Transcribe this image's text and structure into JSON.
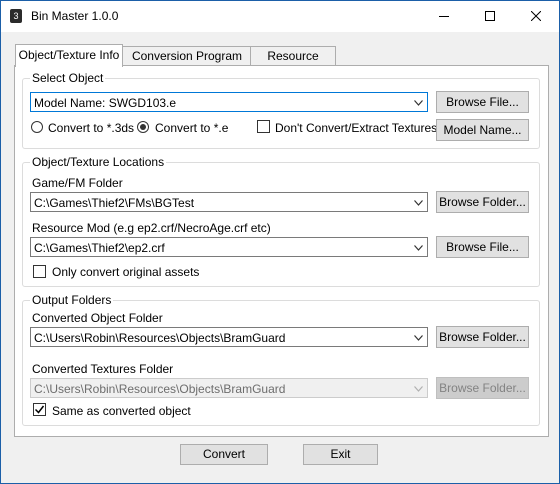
{
  "window": {
    "title": "Bin Master 1.0.0",
    "controls": {
      "minimize": "minimize-icon",
      "maximize": "maximize-icon",
      "close": "close-icon"
    }
  },
  "tabs": [
    {
      "label": "Object/Texture Info",
      "active": true
    },
    {
      "label": "Conversion Program Info",
      "active": false
    },
    {
      "label": "Resource Paths",
      "active": false
    }
  ],
  "select_object": {
    "legend": "Select Object",
    "model_name_value": "Model Name: SWGD103.e",
    "browse_file_label": "Browse File...",
    "radio_3ds_label": "Convert to *.3ds",
    "radio_3ds_checked": false,
    "radio_e_label": "Convert to *.e",
    "radio_e_checked": true,
    "dont_convert_label": "Don't Convert/Extract Textures",
    "dont_convert_checked": false,
    "model_name_button_label": "Model Name..."
  },
  "locations": {
    "legend": "Object/Texture Locations",
    "game_fm_label": "Game/FM Folder",
    "game_fm_value": "C:\\Games\\Thief2\\FMs\\BGTest",
    "browse_folder_label": "Browse Folder...",
    "resource_mod_label": "Resource Mod (e.g ep2.crf/NecroAge.crf etc)",
    "resource_mod_value": "C:\\Games\\Thief2\\ep2.crf",
    "browse_file_label": "Browse File...",
    "only_original_label": "Only convert original assets",
    "only_original_checked": false
  },
  "output": {
    "legend": "Output Folders",
    "converted_object_label": "Converted Object Folder",
    "converted_object_value": "C:\\Users\\Robin\\Resources\\Objects\\BramGuard",
    "browse_folder_label": "Browse Folder...",
    "converted_textures_label": "Converted Textures Folder",
    "converted_textures_value": "C:\\Users\\Robin\\Resources\\Objects\\BramGuard",
    "browse_folder_disabled_label": "Browse Folder...",
    "same_as_label": "Same as converted object",
    "same_as_checked": true
  },
  "footer": {
    "convert_label": "Convert",
    "exit_label": "Exit"
  }
}
